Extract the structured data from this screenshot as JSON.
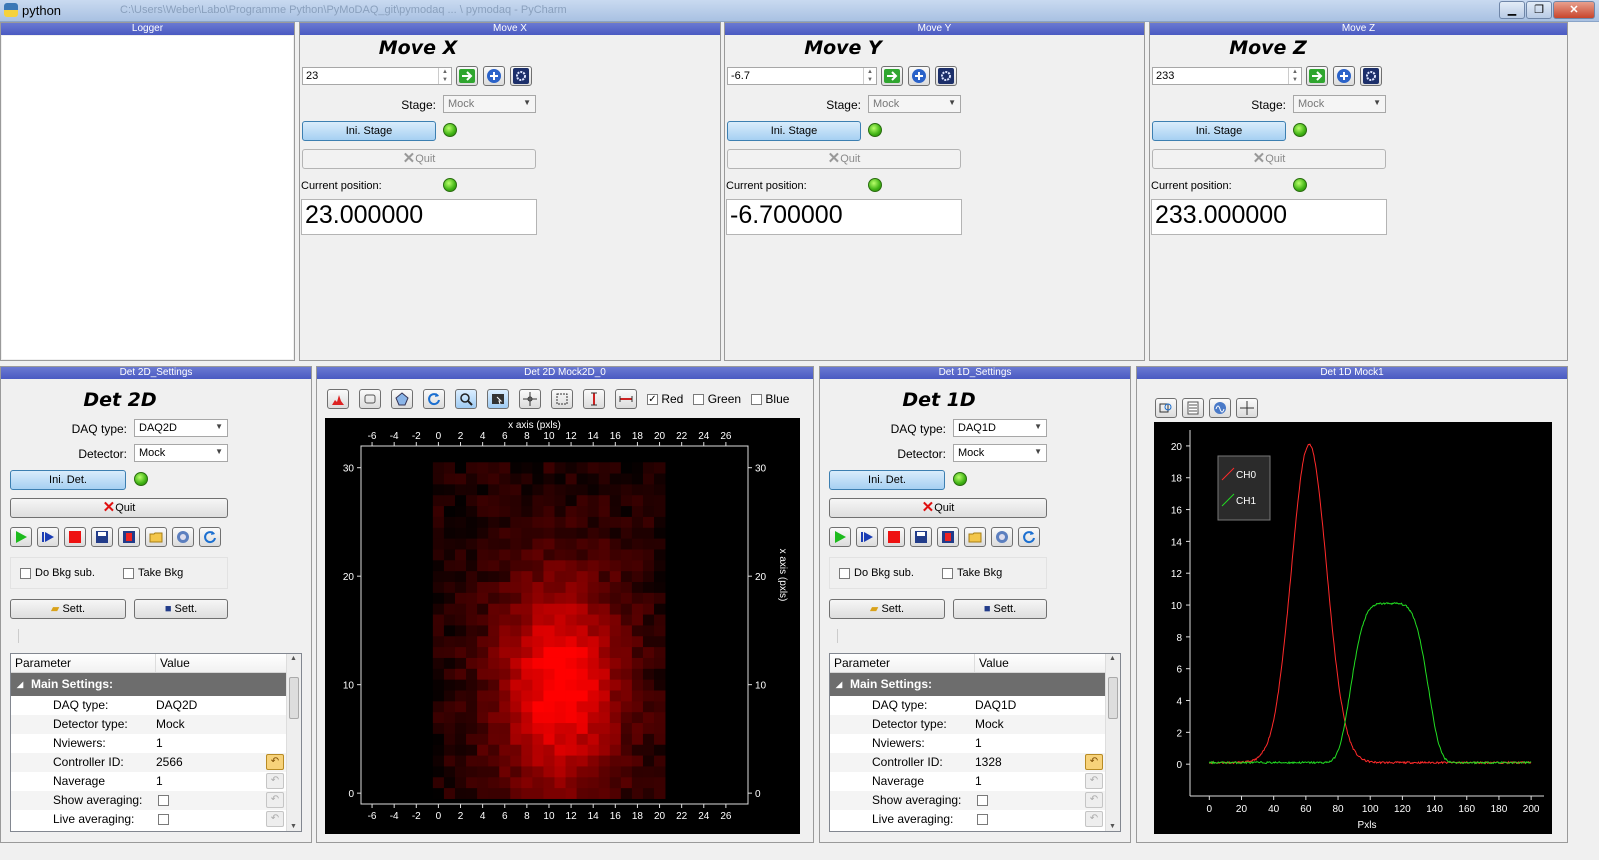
{
  "window": {
    "title": "python",
    "path": "C:\\Users\\Weber\\Labo\\Programme Python\\PyMoDAQ_git\\pymodaq ... \\ pymodaq - PyCharm",
    "min": "▁",
    "max": "❐",
    "close": "✕"
  },
  "docks": {
    "logger": "Logger",
    "move_x": "Move X",
    "move_y": "Move Y",
    "move_z": "Move Z",
    "det2d_settings": "Det 2D_Settings",
    "det2d_view": "Det 2D Mock2D_0",
    "det1d_settings": "Det 1D_Settings",
    "det1d_view": "Det 1D Mock1"
  },
  "movers": [
    {
      "title": "Move X",
      "value": "23",
      "stage_label": "Stage:",
      "stage": "Mock",
      "ini": "Ini. Stage",
      "quit": "Quit",
      "cur_label": "Current position:",
      "position": "23.000000"
    },
    {
      "title": "Move Y",
      "value": "-6.7",
      "stage_label": "Stage:",
      "stage": "Mock",
      "ini": "Ini. Stage",
      "quit": "Quit",
      "cur_label": "Current position:",
      "position": "-6.700000"
    },
    {
      "title": "Move Z",
      "value": "233",
      "stage_label": "Stage:",
      "stage": "Mock",
      "ini": "Ini. Stage",
      "quit": "Quit",
      "cur_label": "Current position:",
      "position": "233.000000"
    }
  ],
  "detectors": [
    {
      "title": "Det 2D",
      "daq_label": "DAQ type:",
      "daq": "DAQ2D",
      "det_label": "Detector:",
      "det": "Mock",
      "ini": "Ini. Det.",
      "quit": "Quit",
      "bkg": "Do Bkg sub.",
      "take_bkg": "Take Bkg",
      "sett1": "Sett.",
      "sett2": "Sett.",
      "tree": {
        "col1": "Parameter",
        "col2": "Value",
        "group": "Main Settings:",
        "rows": [
          {
            "k": "DAQ type:",
            "v": "DAQ2D"
          },
          {
            "k": "Detector type:",
            "v": "Mock"
          },
          {
            "k": "Nviewers:",
            "v": "1"
          },
          {
            "k": "Controller ID:",
            "v": "2566"
          },
          {
            "k": "Naverage",
            "v": "1"
          },
          {
            "k": "Show averaging:",
            "v": ""
          },
          {
            "k": "Live averaging:",
            "v": ""
          }
        ]
      }
    },
    {
      "title": "Det 1D",
      "daq_label": "DAQ type:",
      "daq": "DAQ1D",
      "det_label": "Detector:",
      "det": "Mock",
      "ini": "Ini. Det.",
      "quit": "Quit",
      "bkg": "Do Bkg sub.",
      "take_bkg": "Take Bkg",
      "sett1": "Sett.",
      "sett2": "Sett.",
      "tree": {
        "col1": "Parameter",
        "col2": "Value",
        "group": "Main Settings:",
        "rows": [
          {
            "k": "DAQ type:",
            "v": "DAQ1D"
          },
          {
            "k": "Detector type:",
            "v": "Mock"
          },
          {
            "k": "Nviewers:",
            "v": "1"
          },
          {
            "k": "Controller ID:",
            "v": "1328"
          },
          {
            "k": "Naverage",
            "v": "1"
          },
          {
            "k": "Show averaging:",
            "v": ""
          },
          {
            "k": "Live averaging:",
            "v": ""
          }
        ]
      }
    }
  ],
  "viewer2d": {
    "red": "Red",
    "green": "Green",
    "blue": "Blue",
    "red_checked": true
  },
  "colors": {
    "dock_title": "#5060c8",
    "led": "#3fb214",
    "plot_bg": "#000000",
    "ch0": "#ff2a2a",
    "ch1": "#22dd22"
  },
  "chart_data": [
    {
      "type": "heatmap",
      "title": "",
      "xlabel": "x axis (pxls)",
      "ylabel": "x axis (pxls)",
      "xlim": [
        -7,
        28
      ],
      "ylim": [
        -1,
        32
      ],
      "x_ticks": [
        -6,
        -4,
        -2,
        0,
        2,
        4,
        6,
        8,
        10,
        12,
        14,
        16,
        18,
        20,
        22,
        24,
        26
      ],
      "y_ticks": [
        0,
        10,
        20,
        30
      ],
      "data_extent": {
        "x": [
          0,
          20
        ],
        "y": [
          0,
          30
        ]
      },
      "center": {
        "x": 11,
        "y": 10
      },
      "sigma": {
        "x": 4,
        "y": 7
      },
      "peak": 1.0,
      "colormap": "black-red"
    },
    {
      "type": "line",
      "title": "",
      "xlabel": "Pxls",
      "ylabel": "",
      "xlim": [
        -12,
        208
      ],
      "ylim": [
        -2,
        21
      ],
      "x_ticks": [
        0,
        20,
        40,
        60,
        80,
        100,
        120,
        140,
        160,
        180,
        200
      ],
      "y_ticks": [
        0,
        2,
        4,
        6,
        8,
        10,
        12,
        14,
        16,
        18,
        20
      ],
      "legend": "top-left",
      "series": [
        {
          "name": "CH0",
          "color": "#ff2a2a",
          "shape": "gaussian",
          "center": 62,
          "width": 11,
          "amplitude": 20,
          "offset": 0.1
        },
        {
          "name": "CH1",
          "color": "#22dd22",
          "shape": "supergaussian",
          "center": 112,
          "width": 22,
          "amplitude": 10,
          "offset": 0.1
        }
      ]
    }
  ]
}
